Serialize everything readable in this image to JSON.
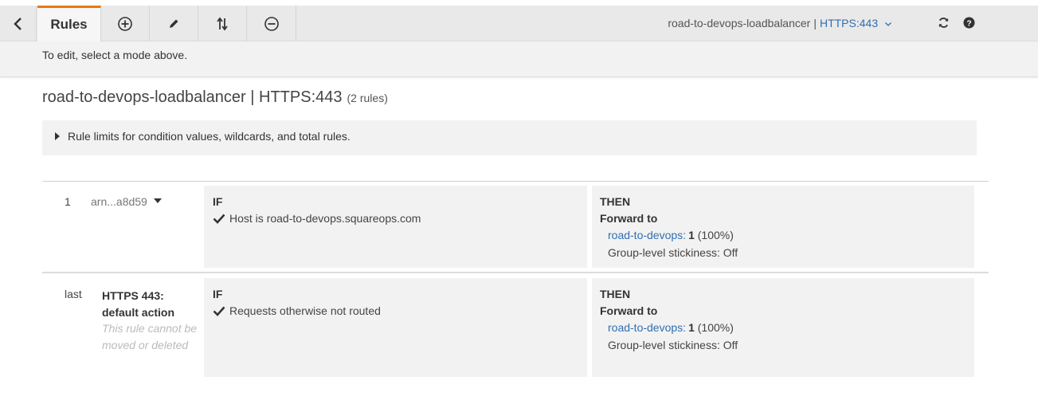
{
  "toolbar": {
    "tabs": {
      "rules": "Rules"
    },
    "listener_name": "road-to-devops-loadbalancer",
    "separator": "|",
    "listener_port": "HTTPS:443",
    "icons": [
      "back-arrow-icon",
      "add-icon",
      "edit-icon",
      "reorder-icon",
      "delete-icon",
      "refresh-icon",
      "help-icon"
    ]
  },
  "hint": "To edit, select a mode above.",
  "page": {
    "title": "road-to-devops-loadbalancer | HTTPS:443",
    "rule_count": "(2 rules)",
    "limits_label": "Rule limits for condition values, wildcards, and total rules."
  },
  "rules": [
    {
      "number": "1",
      "arn": "arn...a8d59",
      "if_label": "IF",
      "condition_prefix": "Host is",
      "condition_value": "road-to-devops.squareops.com",
      "then_label": "THEN",
      "action": "Forward to",
      "target_group": "road-to-devops:",
      "weight": "1",
      "weight_pct": "(100%)",
      "stickiness": "Group-level stickiness: Off"
    },
    {
      "number": "last",
      "name": "HTTPS 443: default action",
      "note": "This rule cannot be moved or deleted",
      "if_label": "IF",
      "condition": "Requests otherwise not routed",
      "then_label": "THEN",
      "action": "Forward to",
      "target_group": "road-to-devops:",
      "weight": "1",
      "weight_pct": "(100%)",
      "stickiness": "Group-level stickiness: Off"
    }
  ],
  "colors": {
    "accent": "#e47911",
    "link": "#2f6fb2"
  }
}
